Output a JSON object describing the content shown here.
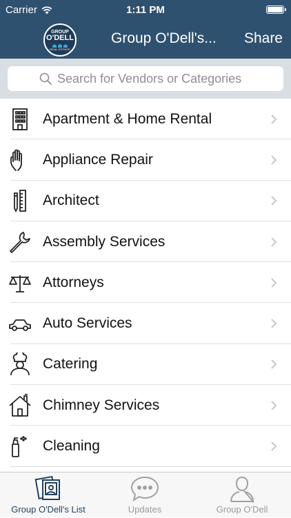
{
  "status_bar": {
    "carrier": "Carrier",
    "time": "1:11 PM"
  },
  "logo": {
    "line1": "GROUP",
    "line2": "O'DELL",
    "line3": "REAL ESTATE"
  },
  "nav": {
    "title": "Group O'Dell's...",
    "share_label": "Share"
  },
  "search": {
    "placeholder": "Search for Vendors or Categories",
    "value": ""
  },
  "categories": [
    {
      "label": "Apartment & Home Rental",
      "icon": "building-icon"
    },
    {
      "label": "Appliance Repair",
      "icon": "hand-icon"
    },
    {
      "label": "Architect",
      "icon": "ruler-pencil-icon"
    },
    {
      "label": "Assembly Services",
      "icon": "wrench-icon"
    },
    {
      "label": "Attorneys",
      "icon": "scales-icon"
    },
    {
      "label": "Auto Services",
      "icon": "car-icon"
    },
    {
      "label": "Catering",
      "icon": "chef-icon"
    },
    {
      "label": "Chimney Services",
      "icon": "house-chimney-icon"
    },
    {
      "label": "Cleaning",
      "icon": "spray-bottle-icon"
    }
  ],
  "tabs": [
    {
      "label": "Group O'Dell's List",
      "icon": "photo-list-icon",
      "active": true
    },
    {
      "label": "Updates",
      "icon": "chat-bubble-icon",
      "active": false
    },
    {
      "label": "Group O'Dell",
      "icon": "person-icon",
      "active": false
    }
  ],
  "colors": {
    "header": "#2f5170",
    "active_tab": "#1f3f5c",
    "inactive_tab": "#9a9a9a"
  }
}
